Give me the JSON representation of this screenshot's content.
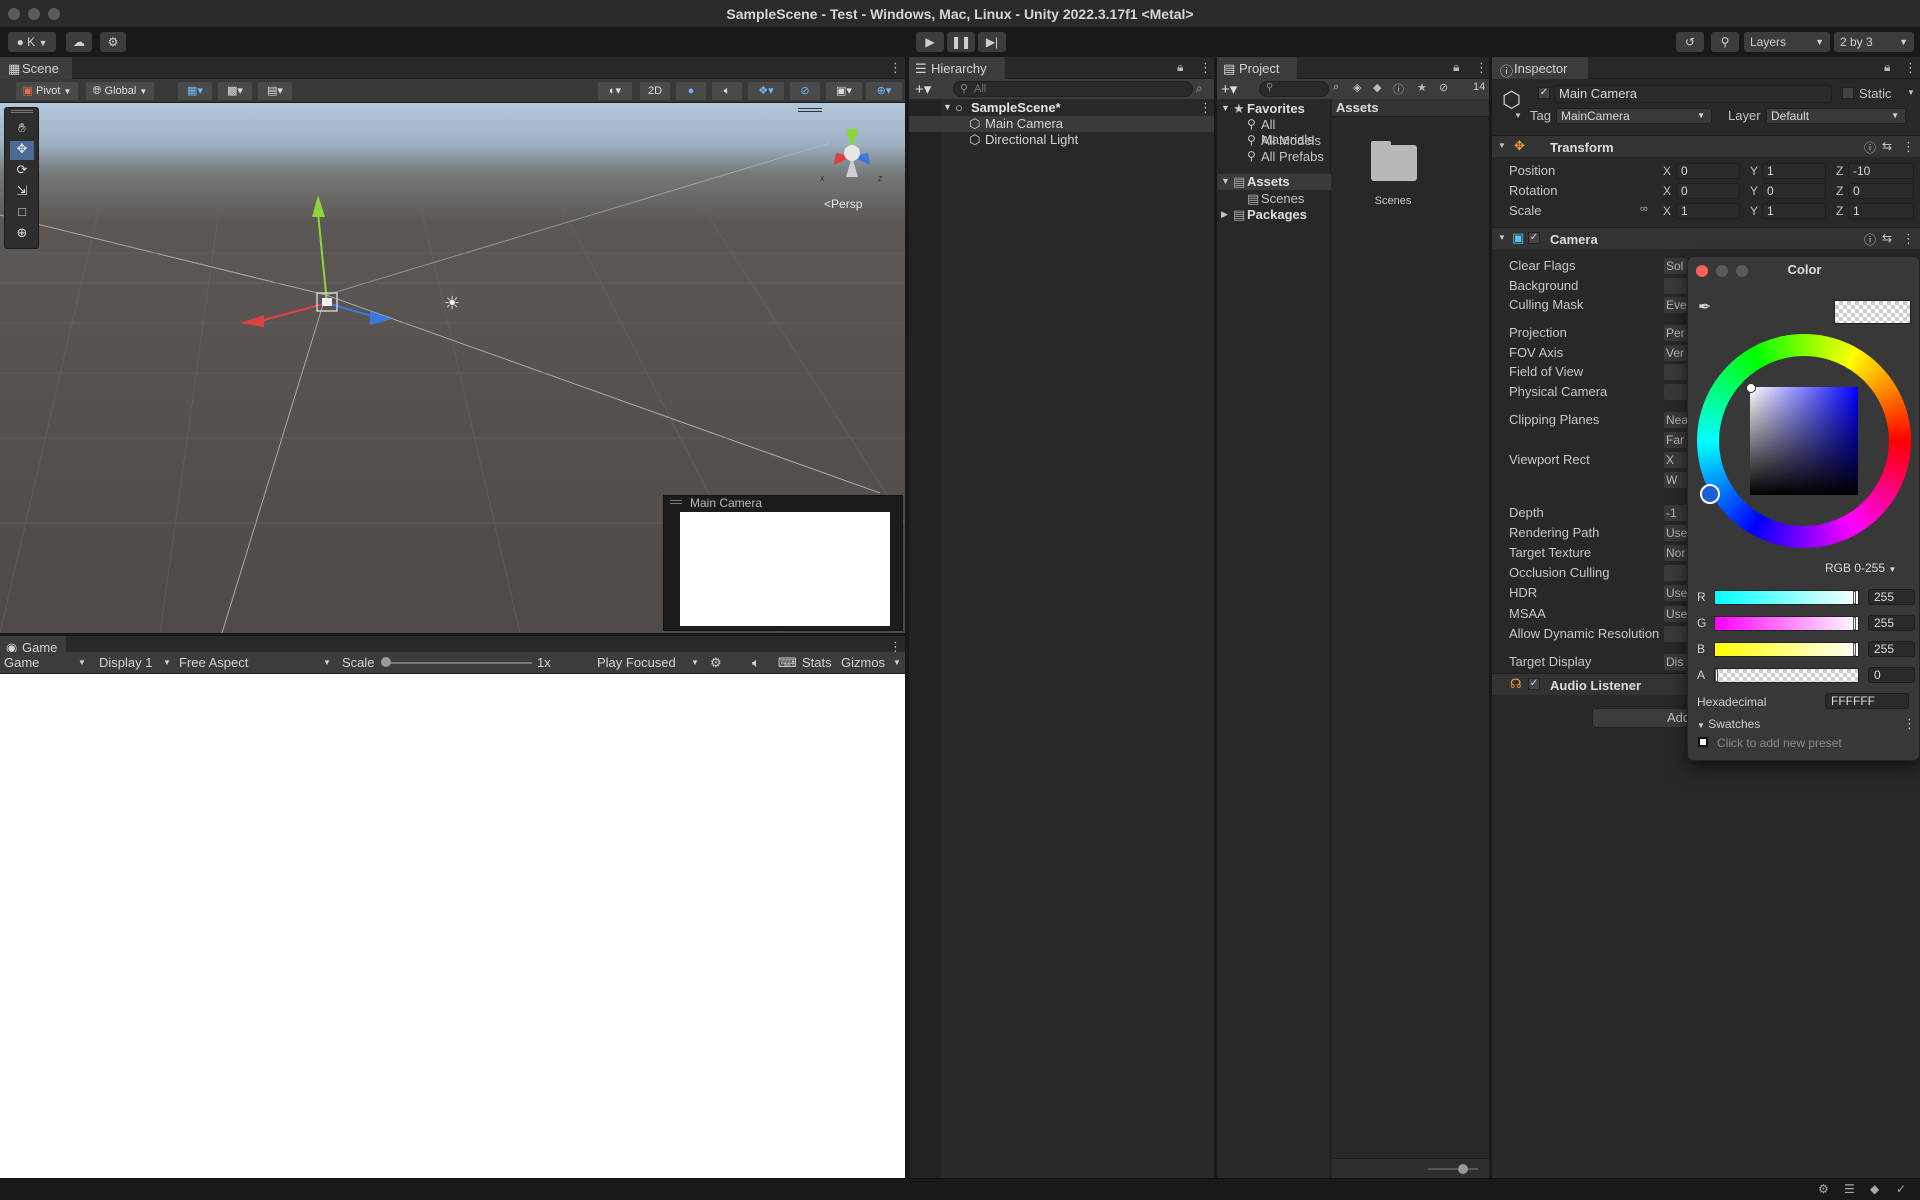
{
  "window": {
    "title": "SampleScene - Test - Windows, Mac, Linux - Unity 2022.3.17f1 <Metal>"
  },
  "toolbar": {
    "account": "K",
    "layers": "Layers",
    "layout": "2 by 3"
  },
  "scene": {
    "tab": "Scene",
    "pivot": "Pivot",
    "global": "Global",
    "mode_2d": "2D",
    "persp": "Persp",
    "camera_preview_title": "Main Camera",
    "gizmo_x": "x",
    "gizmo_z": "z"
  },
  "game": {
    "tab": "Game",
    "mode": "Game",
    "display": "Display 1",
    "aspect": "Free Aspect",
    "scale_label": "Scale",
    "scale_value": "1x",
    "play_focused": "Play Focused",
    "stats": "Stats",
    "gizmos": "Gizmos"
  },
  "hierarchy": {
    "tab": "Hierarchy",
    "search_placeholder": "All",
    "scene": "SampleScene*",
    "items": [
      "Main Camera",
      "Directional Light"
    ]
  },
  "project": {
    "tab": "Project",
    "hidden_count": "14",
    "favorites": "Favorites",
    "favorite_items": [
      "All Materials",
      "All Models",
      "All Prefabs"
    ],
    "assets": "Assets",
    "scenes": "Scenes",
    "packages": "Packages",
    "content_header": "Assets",
    "folder_label": "Scenes"
  },
  "inspector": {
    "tab": "Inspector",
    "object_name": "Main Camera",
    "static": "Static",
    "tag_label": "Tag",
    "tag_value": "MainCamera",
    "layer_label": "Layer",
    "layer_value": "Default",
    "transform": {
      "title": "Transform",
      "position_label": "Position",
      "rotation_label": "Rotation",
      "scale_label": "Scale",
      "position": {
        "x": "0",
        "y": "1",
        "z": "-10"
      },
      "rotation": {
        "x": "0",
        "y": "0",
        "z": "0"
      },
      "scale": {
        "x": "1",
        "y": "1",
        "z": "1"
      }
    },
    "camera": {
      "title": "Camera",
      "fields": [
        {
          "label": "Clear Flags",
          "value": "Sol"
        },
        {
          "label": "Background",
          "value": ""
        },
        {
          "label": "Culling Mask",
          "value": "Eve"
        },
        {
          "label": "Projection",
          "value": "Per"
        },
        {
          "label": "FOV Axis",
          "value": "Ver"
        },
        {
          "label": "Field of View",
          "value": ""
        },
        {
          "label": "Physical Camera",
          "value": ""
        },
        {
          "label": "Clipping Planes",
          "value": "Nea"
        },
        {
          "label": "",
          "value": "Far"
        },
        {
          "label": "Viewport Rect",
          "value": "X"
        },
        {
          "label": "",
          "value": "W"
        },
        {
          "label": "Depth",
          "value": "-1"
        },
        {
          "label": "Rendering Path",
          "value": "Use"
        },
        {
          "label": "Target Texture",
          "value": "Nor"
        },
        {
          "label": "Occlusion Culling",
          "value": ""
        },
        {
          "label": "HDR",
          "value": "Use"
        },
        {
          "label": "MSAA",
          "value": "Use"
        },
        {
          "label": "Allow Dynamic Resolution",
          "value": ""
        },
        {
          "label": "Target Display",
          "value": "Dis"
        }
      ]
    },
    "audio_listener": "Audio Listener",
    "add_component": "Add"
  },
  "color_picker": {
    "title": "Color",
    "mode": "RGB 0-255",
    "r_label": "R",
    "g_label": "G",
    "b_label": "B",
    "a_label": "A",
    "r": "255",
    "g": "255",
    "b": "255",
    "a": "0",
    "r_fraction": 1.0,
    "g_fraction": 1.0,
    "b_fraction": 1.0,
    "a_fraction": 0.0,
    "hex_label": "Hexadecimal",
    "hex": "FFFFFF",
    "swatches": "Swatches",
    "add_preset": "Click to add new preset"
  }
}
